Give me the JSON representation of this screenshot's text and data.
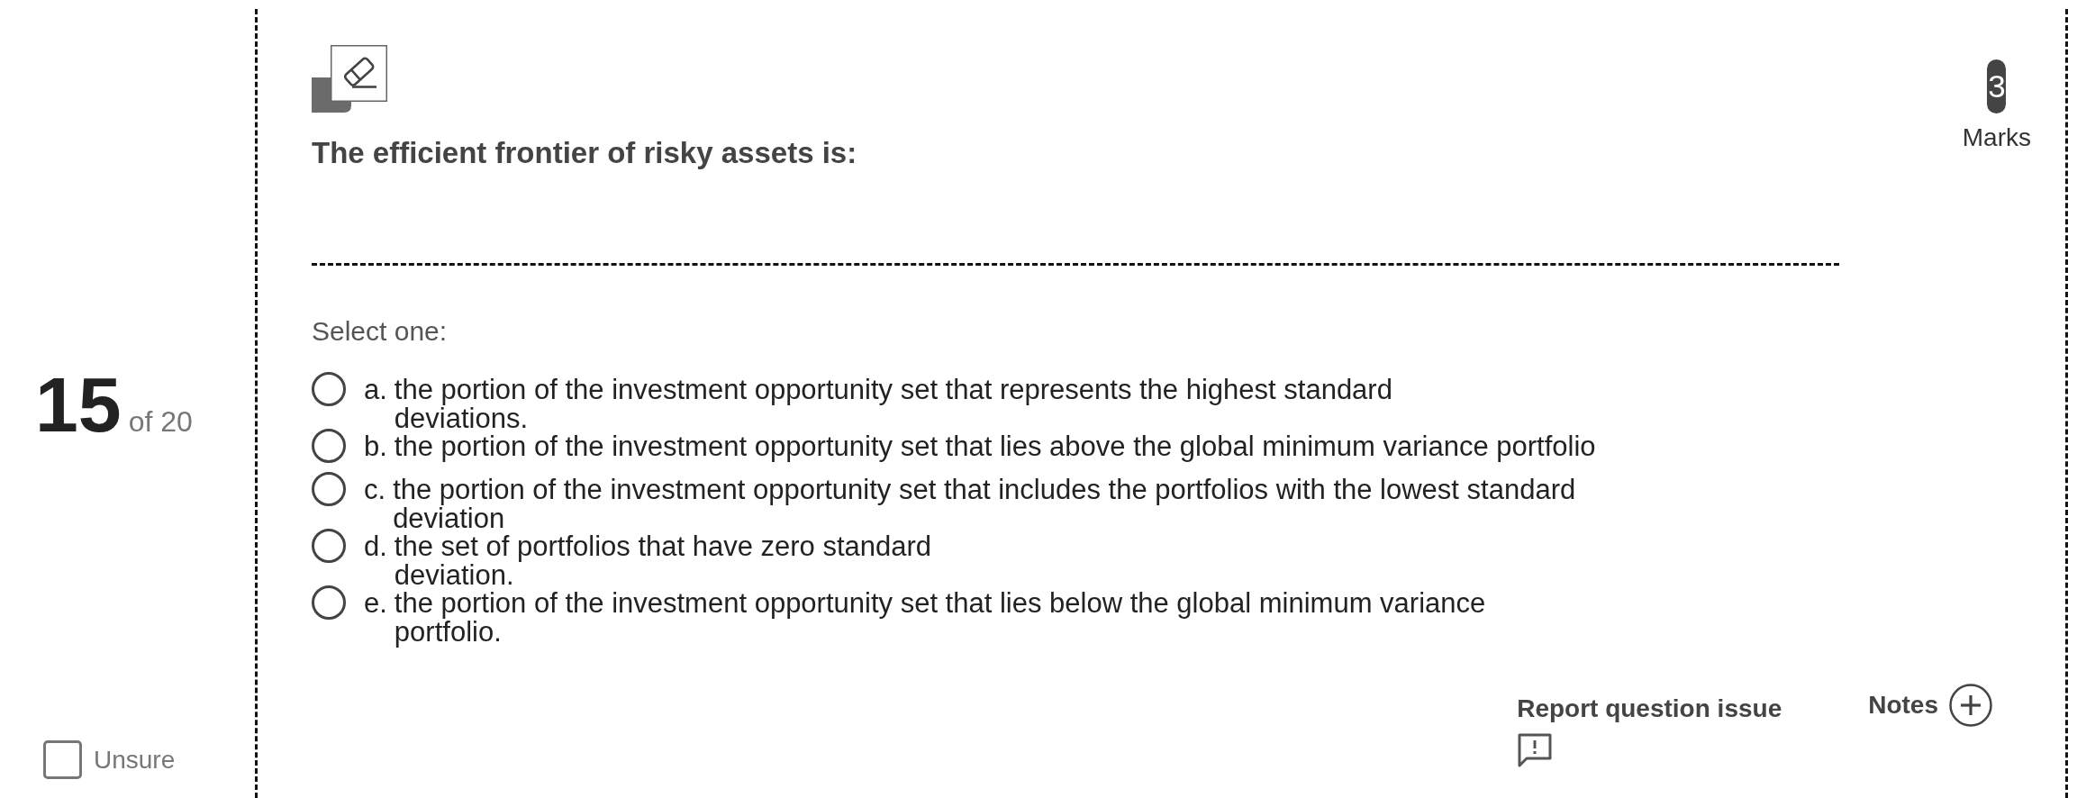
{
  "question": {
    "number": "15",
    "total": "of 20",
    "marks": "3",
    "marks_label": "Marks",
    "text": "The efficient frontier of risky assets is:",
    "prompt": "Select one:"
  },
  "options": [
    {
      "letter": "a.",
      "text": "the portion of the investment opportunity set that represents the highest standard\ndeviations.",
      "selected": false
    },
    {
      "letter": "b.",
      "text": "the portion of the investment opportunity set that lies above the global minimum variance portfolio",
      "selected": false
    },
    {
      "letter": "c.",
      "text": "the portion of the investment opportunity set that includes the portfolios with the lowest standard\ndeviation",
      "selected": false
    },
    {
      "letter": "d.",
      "text": "the set of portfolios that have zero standard\ndeviation.",
      "selected": false
    },
    {
      "letter": "e.",
      "text": "the portion of the investment opportunity set that lies below the global minimum variance\nportfolio.",
      "selected": false
    }
  ],
  "unsure": {
    "label": "Unsure",
    "checked": false
  },
  "footer": {
    "report": "Report question issue",
    "notes": "Notes"
  }
}
